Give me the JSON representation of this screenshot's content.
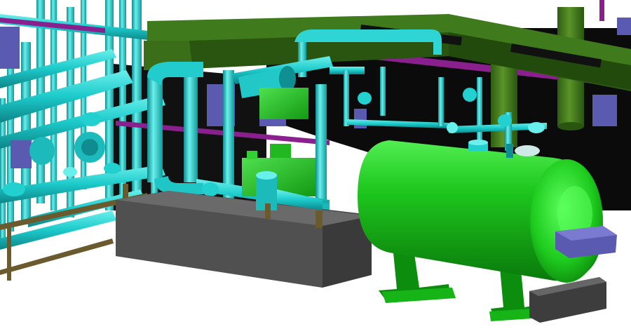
{
  "scene": {
    "kind": "3d-plant-model-render",
    "background_color": "#ffffff",
    "colors": {
      "pipe_cyan": "#19c9c9",
      "pipe_cyan_dark": "#0f8f92",
      "pipe_cyan_light": "#7ff0ee",
      "vessel_green": "#17c017",
      "vessel_green_dark": "#0a7a0a",
      "vessel_green_light": "#4cff4c",
      "duct_olive": "#2c5a12",
      "duct_olive_light": "#3f7a1c",
      "column_olive": "#4a7f20",
      "magenta_pipe": "#8a1f8e",
      "equipment_purple": "#5a5ab0",
      "concrete_grey": "#4a4a4a",
      "concrete_grey_top": "#6a6a6a",
      "frame_brown": "#6b5a2e",
      "interior_dark": "#0b0b0b"
    },
    "objects": [
      "overhead-duct",
      "horizontal-pressure-vessel",
      "vessel-saddle-support",
      "concrete-plinth",
      "pump-skid",
      "pipe-rack",
      "valve",
      "flange",
      "instrument-box"
    ]
  }
}
